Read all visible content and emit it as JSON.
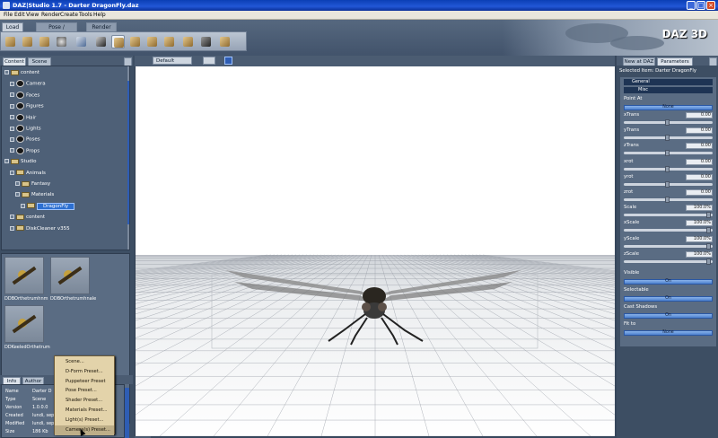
{
  "window": {
    "title": "DAZ|Studio 1.7 - Darter DragonFly.daz",
    "controls": [
      "_",
      "□",
      "×"
    ]
  },
  "menubar": [
    "File",
    "Edit",
    "View",
    "Render",
    "Create",
    "Tools",
    "Help"
  ],
  "top_tabs": [
    "Load",
    "Pose / Animate",
    "Render"
  ],
  "toolbar_icons": [
    "new-icon",
    "open-icon",
    "save-icon",
    "stop-icon",
    "import-icon",
    "select-icon",
    "translate-icon",
    "rotate-icon",
    "move-icon",
    "scale-icon",
    "bend-icon",
    "twist-icon",
    "link-icon",
    "settings-icon"
  ],
  "logo": "DAZ 3D",
  "left_panel": {
    "tabs": [
      "Content",
      "Scene"
    ],
    "tree": [
      {
        "label": "content",
        "level": 0,
        "icon": "folder"
      },
      {
        "label": "Camera",
        "level": 1,
        "icon": "ball"
      },
      {
        "label": "Faces",
        "level": 1,
        "icon": "ball"
      },
      {
        "label": "Figures",
        "level": 1,
        "icon": "ball"
      },
      {
        "label": "Hair",
        "level": 1,
        "icon": "ball"
      },
      {
        "label": "Lights",
        "level": 1,
        "icon": "ball"
      },
      {
        "label": "Poses",
        "level": 1,
        "icon": "ball"
      },
      {
        "label": "Props",
        "level": 1,
        "icon": "ball"
      },
      {
        "label": "Studio",
        "level": 0,
        "icon": "folder"
      },
      {
        "label": "Animals",
        "level": 1,
        "icon": "folder"
      },
      {
        "label": "Fantasy",
        "level": 2,
        "icon": "folder"
      },
      {
        "label": "Materials",
        "level": 2,
        "icon": "folder"
      },
      {
        "label": "DragonFly",
        "level": 3,
        "icon": "folder",
        "selected": true
      },
      {
        "label": "content",
        "level": 1,
        "icon": "folder"
      },
      {
        "label": "DiskCleaner v355",
        "level": 1,
        "icon": "folder"
      }
    ],
    "thumbnails": [
      "DDBOrthetrumhnm",
      "DDBOrthetrumhnale",
      "DDKeeledOrthetrum"
    ],
    "info_tabs": [
      "Info",
      "Author"
    ],
    "info": [
      {
        "key": "Name",
        "value": "Darter D"
      },
      {
        "key": "Type",
        "value": "Scene"
      },
      {
        "key": "Version",
        "value": "1.0.0.0"
      },
      {
        "key": "Created",
        "value": "lundi, sept"
      },
      {
        "key": "Modified",
        "value": "lundi, sept"
      },
      {
        "key": "Size",
        "value": "186 Kb"
      }
    ]
  },
  "viewport": {
    "camera": "Default Camera"
  },
  "right_panel": {
    "tabs": [
      "New at DAZ",
      "Parameters"
    ],
    "selected_item": "Selected Item: Darter DragonFly",
    "sections": {
      "general": "General",
      "misc": "Misc"
    },
    "point_at": {
      "label": "Point At",
      "value": "None"
    },
    "params": [
      {
        "name": "xTrans",
        "value": "0.00"
      },
      {
        "name": "yTrans",
        "value": "0.00"
      },
      {
        "name": "zTrans",
        "value": "0.00"
      },
      {
        "name": "xrot",
        "value": "0.00"
      },
      {
        "name": "yrot",
        "value": "0.00"
      },
      {
        "name": "zrot",
        "value": "0.00"
      },
      {
        "name": "Scale",
        "value": "100.0%"
      },
      {
        "name": "xScale",
        "value": "100.0%"
      },
      {
        "name": "yScale",
        "value": "100.0%"
      },
      {
        "name": "zScale",
        "value": "100.0%"
      }
    ],
    "toggles": [
      {
        "name": "Visible",
        "value": "On"
      },
      {
        "name": "Selectable",
        "value": "On"
      },
      {
        "name": "Cast Shadows",
        "value": "On"
      },
      {
        "name": "Fit to",
        "value": "None"
      }
    ]
  },
  "popup_menu": [
    "Scene...",
    "D-Form Preset...",
    "Puppeteer Preset",
    "Pose Preset...",
    "Shader Preset...",
    "Materials Preset...",
    "Light(s) Preset...",
    "Camera(s) Preset..."
  ],
  "colors": {
    "accent": "#2c6fd1",
    "panel": "#3d4e63",
    "titlebar": "#0b3fb5"
  }
}
